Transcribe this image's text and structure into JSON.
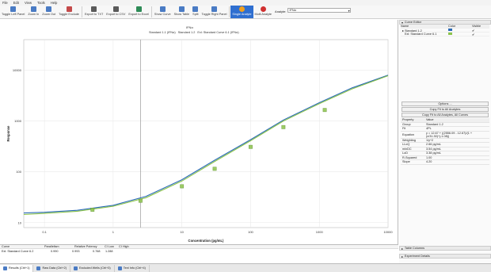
{
  "menu": [
    "File",
    "Edit",
    "View",
    "Tools",
    "Help"
  ],
  "toolbar": {
    "items": [
      {
        "label": "Toggle Left Panel",
        "icon": "panel-left-icon",
        "color": "#4a7bc4"
      },
      {
        "label": "Zoom In",
        "icon": "zoom-in-icon",
        "color": "#4a7bc4"
      },
      {
        "label": "Zoom Out",
        "icon": "zoom-out-icon",
        "color": "#4a7bc4"
      },
      {
        "label": "Toggle Exclude",
        "icon": "exclude-icon",
        "color": "#c44a4a"
      },
      {
        "label": "Export to TXT",
        "icon": "export-txt-icon",
        "color": "#5a5a5a"
      },
      {
        "label": "Export to CSV",
        "icon": "export-csv-icon",
        "color": "#5a5a5a"
      },
      {
        "label": "Export to Excel",
        "icon": "export-excel-icon",
        "color": "#2e8b57"
      },
      {
        "label": "Show Curve",
        "icon": "curve-icon",
        "color": "#4a7bc4"
      },
      {
        "label": "Show Table",
        "icon": "table-icon",
        "color": "#4a7bc4"
      },
      {
        "label": "Split",
        "icon": "split-icon",
        "color": "#4a7bc4"
      },
      {
        "label": "Toggle Right Panel",
        "icon": "panel-right-icon",
        "color": "#4a7bc4"
      },
      {
        "label": "Single Analyte",
        "icon": "single-analyte-icon",
        "color": "#f0a020"
      },
      {
        "label": "Multi Analyte",
        "icon": "multi-analyte-icon",
        "color": "#d03030"
      }
    ],
    "analyte_label": "Analyte:",
    "analyte_value": "IFNα"
  },
  "chart_data": {
    "type": "line",
    "title": "IFNα",
    "xlabel": "Concentration (pg/mL)",
    "ylabel": "Response",
    "x_scale": "log",
    "y_scale": "log",
    "xlim": [
      0.05,
      10000
    ],
    "ylim": [
      8,
      40000
    ],
    "x_ticks": [
      0.1,
      1,
      10,
      100,
      1000,
      10000
    ],
    "x_tick_labels": [
      "0.1",
      "1",
      "10",
      "100",
      "1000",
      "10000"
    ],
    "y_ticks": [
      10,
      100,
      1000,
      10000
    ],
    "y_tick_labels": [
      "10",
      "100",
      "1000",
      "10000"
    ],
    "legend": [
      "Standard 1.1 (IFNα)",
      "Standard 1.2",
      "Exl: Standard Curve 6.1 (IFNα)"
    ],
    "series": [
      {
        "name": "Standard 1.2",
        "color": "#2a6ab8",
        "x": [
          0.05,
          0.1,
          0.3,
          1,
          3,
          10,
          30,
          100,
          300,
          1000,
          3000,
          10000
        ],
        "y": [
          15.5,
          16,
          17.5,
          22,
          33,
          70,
          170,
          430,
          1050,
          2300,
          4500,
          8000
        ]
      },
      {
        "name": "Exl: Standard Curve 6.1",
        "color": "#8bc34a",
        "x": [
          0.05,
          0.1,
          0.3,
          1,
          3,
          10,
          30,
          100,
          300,
          1000,
          3000,
          10000
        ],
        "y": [
          14.5,
          15.2,
          16.8,
          21,
          31,
          66,
          160,
          410,
          1000,
          2200,
          4300,
          7800
        ]
      }
    ],
    "points": {
      "color": "#8bc34a",
      "x": [
        0.5,
        2.5,
        10,
        30,
        100,
        300,
        1200
      ],
      "y": [
        18,
        27,
        52,
        115,
        310,
        760,
        1650
      ]
    }
  },
  "bottom_table": {
    "headers": [
      "Curve",
      "Parallelism",
      "Relative Potency",
      "CI Low",
      "CI High"
    ],
    "row": [
      "Exl: Standard Curve 6.2",
      "0.990",
      "0.993",
      "0.768",
      "1.288"
    ]
  },
  "tabs": [
    {
      "label": "Results (Ctrl+1)",
      "icon": "results-icon",
      "color": "#4a7bc4"
    },
    {
      "label": "Raw Data (Ctrl+2)",
      "icon": "raw-data-icon",
      "color": "#4a7bc4"
    },
    {
      "label": "Excluded Wells (Ctrl+3)",
      "icon": "excluded-wells-icon",
      "color": "#4a7bc4"
    },
    {
      "label": "Text Info (Ctrl+4)",
      "icon": "text-info-icon",
      "color": "#4a7bc4"
    }
  ],
  "curve_editor": {
    "title": "Curve Editor",
    "columns": [
      "Name",
      "Color",
      "Visible"
    ],
    "rows": [
      {
        "name": "Standard 1.2",
        "color": "#2a6ab8",
        "visible": "✔"
      },
      {
        "name": "Exl: Standard Curve 6.1",
        "color": "#8bc34a",
        "visible": "✔"
      }
    ],
    "options_btn": "Options ...",
    "copy_btn": "Copy Fit to All Analytes",
    "copy_all_btn": "Copy Fit to All Analytes, All Curves"
  },
  "properties": {
    "headers": [
      "Property",
      "Value"
    ],
    "rows": [
      [
        "Group",
        "Standard 1.2"
      ],
      [
        "Fit",
        "4PL"
      ],
      [
        "Equation",
        "y = 12.67 + ((2556.09 - 12.67)/(1 + (x/31.30)^(-1.08))"
      ],
      [
        "Weighting",
        "1/y^2"
      ],
      [
        "LLoQ",
        "2.66 pg/mL"
      ],
      [
        "minDC",
        "3.54 pg/mL"
      ],
      [
        "LoD",
        "3.38 pg/mL"
      ],
      [
        "R-Squared",
        "1.00"
      ],
      [
        "Slope",
        "4.20"
      ]
    ]
  },
  "right_bottom": {
    "table_columns": "Table Columns",
    "experiment_details": "Experiment Details"
  }
}
